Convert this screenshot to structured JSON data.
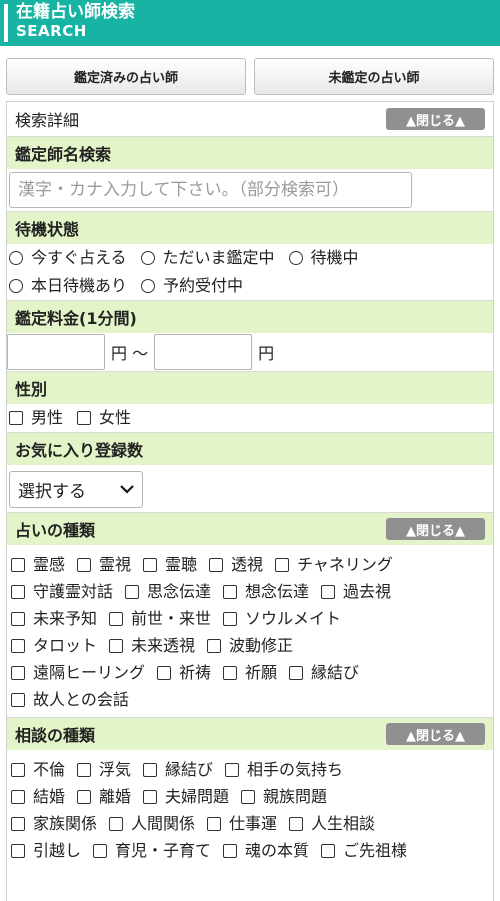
{
  "header": {
    "title": "在籍占い師検索",
    "subtitle": "SEARCH"
  },
  "tabs": [
    {
      "label": "鑑定済みの占い師"
    },
    {
      "label": "未鑑定の占い師"
    }
  ],
  "search_details": {
    "label": "検索詳細",
    "toggle": "▲閉じる▲"
  },
  "name_search": {
    "heading": "鑑定師名検索",
    "placeholder": "漢字・カナ入力して下さい。（部分検索可）"
  },
  "status": {
    "heading": "待機状態",
    "options": [
      "今すぐ占える",
      "ただいま鑑定中",
      "待機中",
      "本日待機あり",
      "予約受付中"
    ]
  },
  "fee": {
    "heading": "鑑定料金(1分間)",
    "from_unit": "円 〜",
    "to_unit": "円"
  },
  "gender": {
    "heading": "性別",
    "options": [
      "男性",
      "女性"
    ]
  },
  "favorites": {
    "heading": "お気に入り登録数",
    "selected": "選択する"
  },
  "fortune_types": {
    "heading": "占いの種類",
    "toggle": "▲閉じる▲",
    "rows": [
      [
        "霊感",
        "霊視",
        "霊聴",
        "透視",
        "チャネリング"
      ],
      [
        "守護霊対話",
        "思念伝達",
        "想念伝達",
        "過去視"
      ],
      [
        "未来予知",
        "前世・来世",
        "ソウルメイト"
      ],
      [
        "タロット",
        "未来透視",
        "波動修正"
      ],
      [
        "遠隔ヒーリング",
        "祈祷",
        "祈願",
        "縁結び"
      ],
      [
        "故人との会話"
      ]
    ]
  },
  "consult_types": {
    "heading": "相談の種類",
    "toggle": "▲閉じる▲",
    "rows": [
      [
        "不倫",
        "浮気",
        "縁結び",
        "相手の気持ち"
      ],
      [
        "結婚",
        "離婚",
        "夫婦問題",
        "親族問題"
      ],
      [
        "家族関係",
        "人間関係",
        "仕事運",
        "人生相談"
      ],
      [
        "引越し",
        "育児・子育て",
        "魂の本質",
        "ご先祖様"
      ]
    ]
  }
}
